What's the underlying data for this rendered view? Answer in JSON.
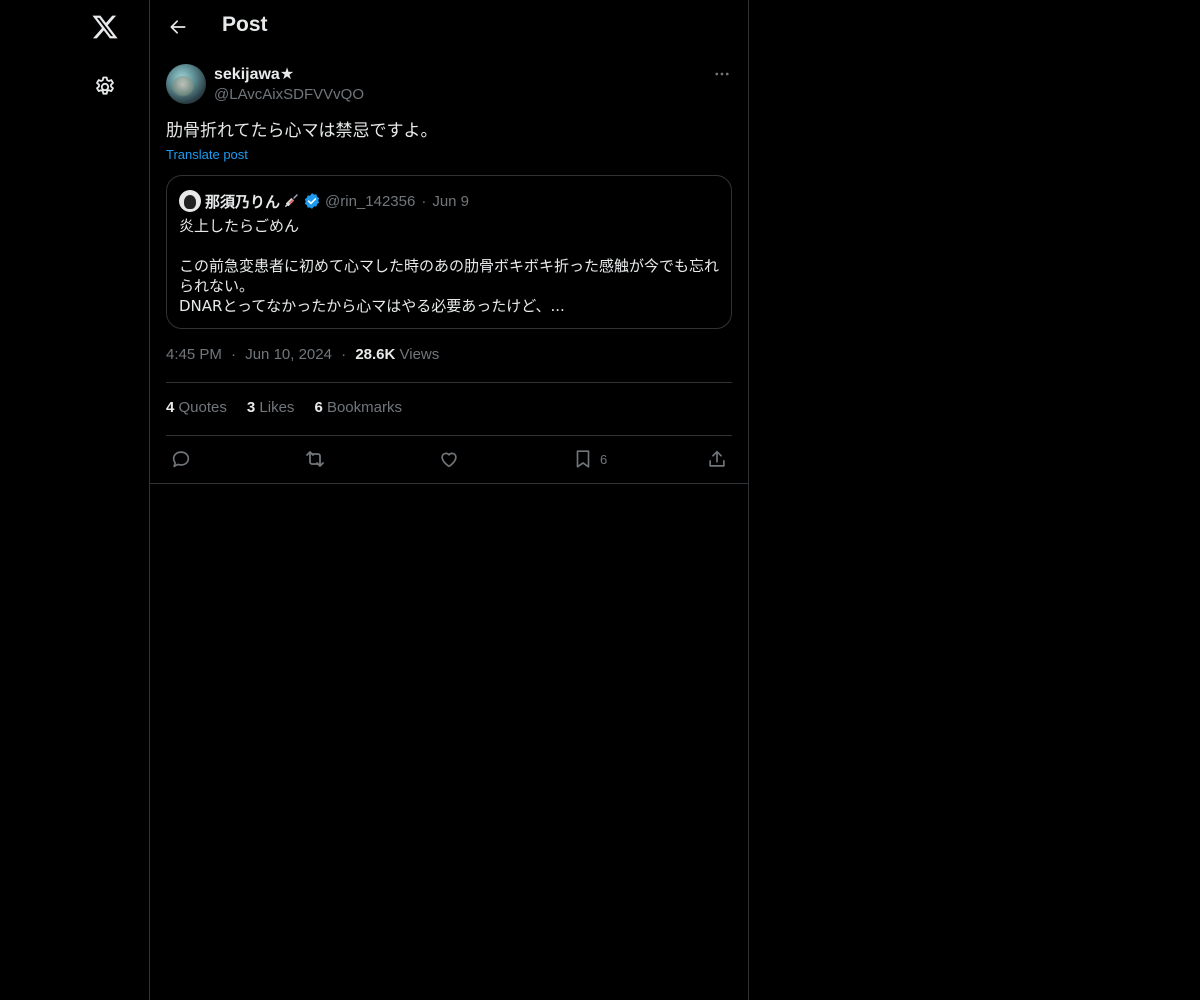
{
  "sidebar": {
    "logo_icon": "x-logo-icon",
    "settings_icon": "gear-icon"
  },
  "header": {
    "back_icon": "arrow-left-icon",
    "title": "Post"
  },
  "post": {
    "display_name": "sekijawa★",
    "handle": "@LAvcAixSDFVVvQO",
    "text": "肋骨折れてたら心マは禁忌ですよ。",
    "translate_label": "Translate post",
    "more_icon": "more-horizontal-icon",
    "quote": {
      "display_name": "那須乃りん",
      "handle": "@rin_142356",
      "separator": "·",
      "date": "Jun 9",
      "line1": "炎上したらごめん",
      "line2": "この前急変患者に初めて心マした時のあの肋骨ボキボキ折った感触が今でも忘れ",
      "line3": "られない。",
      "line4": "DNARとってなかったから心マはやる必要あったけど、..."
    },
    "meta": {
      "time": "4:45 PM",
      "separator": "·",
      "date": "Jun 10, 2024",
      "views_count": "28.6K",
      "views_label": "Views"
    },
    "stats": {
      "quotes_count": "4",
      "quotes_label": "Quotes",
      "likes_count": "3",
      "likes_label": "Likes",
      "bookmarks_count": "6",
      "bookmarks_label": "Bookmarks"
    },
    "actions": {
      "reply_icon": "reply-icon",
      "repost_icon": "repost-icon",
      "like_icon": "heart-icon",
      "bookmark_icon": "bookmark-icon",
      "bookmark_count": "6",
      "share_icon": "share-icon"
    }
  },
  "colors": {
    "background": "#000000",
    "text": "#e7e9ea",
    "muted": "#71767b",
    "link": "#1d9bf0",
    "border": "#2f3336",
    "verified": "#1d9bf0"
  }
}
